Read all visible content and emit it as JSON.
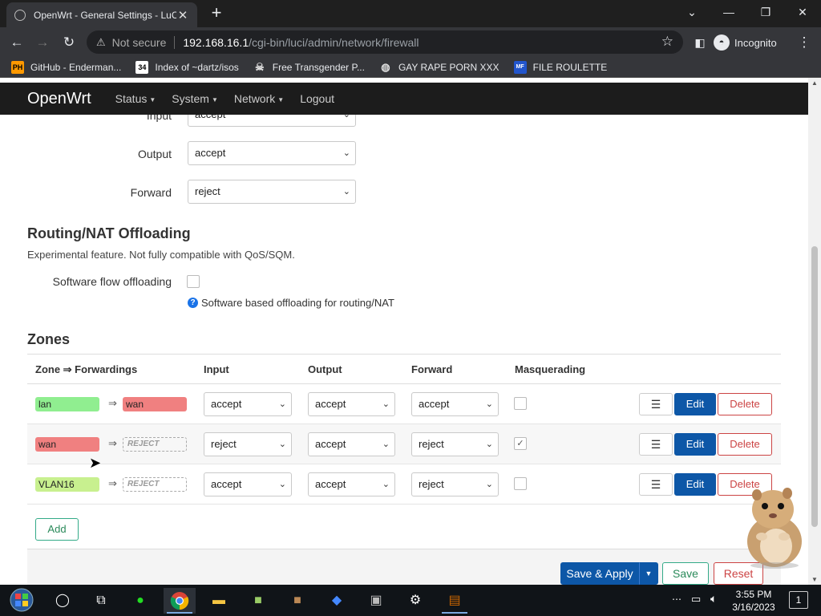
{
  "browser": {
    "tab_title": "OpenWrt - General Settings - LuC",
    "tab_close": "✕",
    "new_tab": "+",
    "url_warning": "Not secure",
    "url_host": "192.168.16.1",
    "url_path": "/cgi-bin/luci/admin/network/firewall",
    "profile": "Incognito",
    "bookmarks": [
      {
        "label": "GitHub - Enderman...",
        "icon": "PH"
      },
      {
        "label": "Index of ~dartz/isos",
        "icon": "34"
      },
      {
        "label": "Free Transgender P...",
        "icon": "skull-icon"
      },
      {
        "label": "GAY RAPE PORN XXX",
        "icon": "globe-icon"
      },
      {
        "label": "FILE ROULETTE",
        "icon": "MF"
      }
    ]
  },
  "header": {
    "brand": "OpenWrt",
    "menu": [
      "Status",
      "System",
      "Network",
      "Logout"
    ]
  },
  "defaults": {
    "input_label": "Input",
    "input_value": "accept",
    "output_label": "Output",
    "output_value": "accept",
    "forward_label": "Forward",
    "forward_value": "reject"
  },
  "offloading": {
    "title": "Routing/NAT Offloading",
    "description": "Experimental feature. Not fully compatible with QoS/SQM.",
    "sw_label": "Software flow offloading",
    "sw_checked": false,
    "help": "Software based offloading for routing/NAT"
  },
  "zones": {
    "title": "Zones",
    "headers": [
      "Zone ⇒ Forwardings",
      "Input",
      "Output",
      "Forward",
      "Masquerading"
    ],
    "arrow": "⇒",
    "rows": [
      {
        "zone": "lan",
        "zone_color": "#90ee90",
        "dest": "wan",
        "dest_color": "#f08080",
        "dest_reject": false,
        "input": "accept",
        "output": "accept",
        "forward": "accept",
        "masq": false
      },
      {
        "zone": "wan",
        "zone_color": "#f08080",
        "dest": "REJECT",
        "dest_color": "",
        "dest_reject": true,
        "input": "reject",
        "output": "accept",
        "forward": "reject",
        "masq": true
      },
      {
        "zone": "VLAN16",
        "zone_color": "#c8f08f",
        "dest": "REJECT",
        "dest_color": "",
        "dest_reject": true,
        "input": "accept",
        "output": "accept",
        "forward": "reject",
        "masq": false
      }
    ],
    "btn_menu": "☰",
    "btn_edit": "Edit",
    "btn_delete": "Delete",
    "btn_add": "Add"
  },
  "footer": {
    "save_apply": "Save & Apply",
    "save": "Save",
    "reset": "Reset"
  },
  "taskbar": {
    "time": "3:55 PM",
    "date": "3/16/2023",
    "notification_count": "1"
  },
  "colors": {
    "header_bg": "#1c1c1c",
    "primary": "#0d57a7",
    "danger": "#cc4444",
    "positive": "#2a8a5a"
  }
}
